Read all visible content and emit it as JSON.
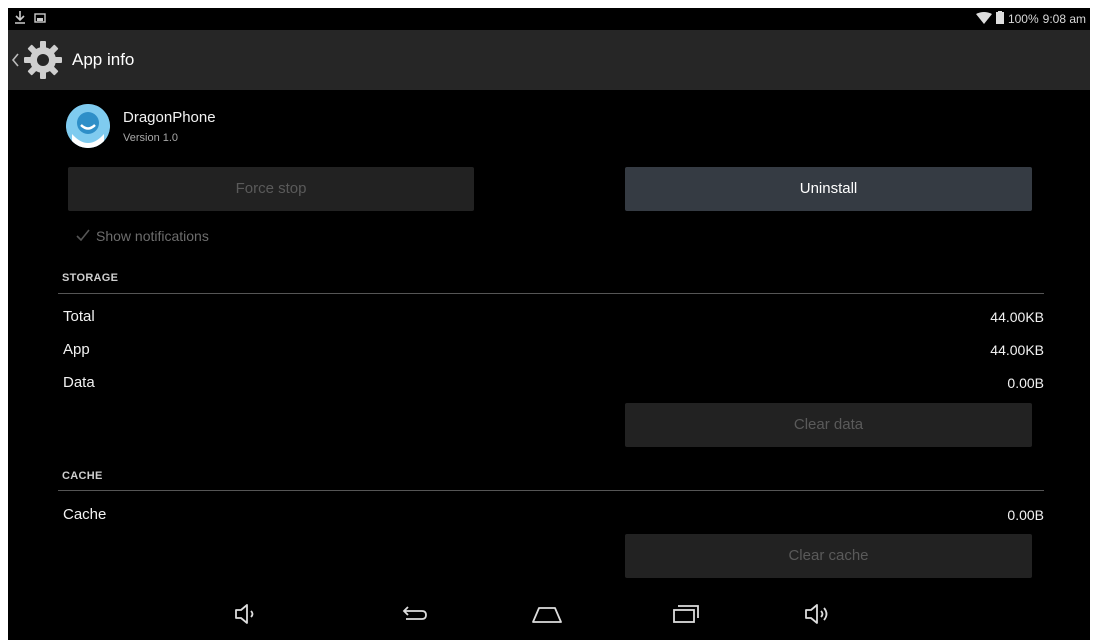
{
  "status_bar": {
    "battery": "100%",
    "time": "9:08 am",
    "icons": [
      "download-icon",
      "image-icon",
      "wifi-icon",
      "battery-icon"
    ]
  },
  "action_bar": {
    "title": "App info",
    "icons": [
      "back-chevron-icon",
      "settings-gear-icon"
    ]
  },
  "app": {
    "name": "DragonPhone",
    "version": "Version 1.0",
    "icon": "dragonphone-app-icon"
  },
  "buttons": {
    "force_stop": "Force stop",
    "uninstall": "Uninstall",
    "clear_data": "Clear data",
    "clear_cache": "Clear cache"
  },
  "notifications": {
    "label": "Show notifications",
    "checked": true
  },
  "storage": {
    "header": "STORAGE",
    "rows": [
      {
        "label": "Total",
        "value": "44.00KB"
      },
      {
        "label": "App",
        "value": "44.00KB"
      },
      {
        "label": "Data",
        "value": "0.00B"
      }
    ]
  },
  "cache": {
    "header": "CACHE",
    "rows": [
      {
        "label": "Cache",
        "value": "0.00B"
      }
    ]
  },
  "nav_bar": {
    "icons": [
      "volume-down-icon",
      "back-icon",
      "home-icon",
      "recent-apps-icon",
      "volume-up-icon"
    ]
  },
  "colors": {
    "background": "#000000",
    "action_bar": "#262626",
    "enabled_button": "#353b43",
    "disabled_button": "#222222",
    "app_icon_blue": "#7fcbef"
  }
}
